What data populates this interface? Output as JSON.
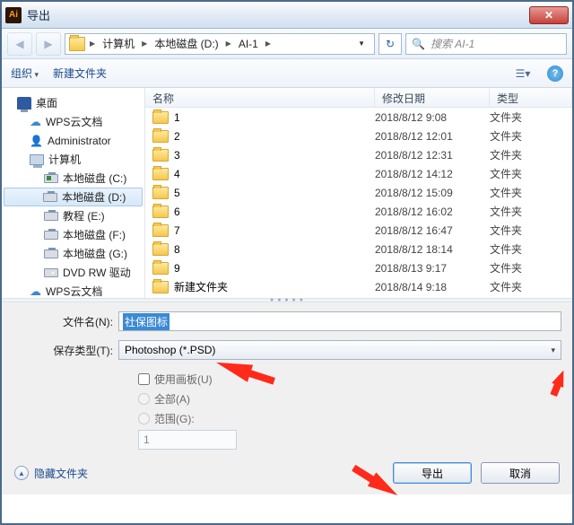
{
  "window": {
    "title": "导出"
  },
  "breadcrumb": {
    "parts": [
      "计算机",
      "本地磁盘 (D:)",
      "AI-1"
    ]
  },
  "search": {
    "placeholder": "搜索 AI-1"
  },
  "toolbar": {
    "organize": "组织",
    "newfolder": "新建文件夹"
  },
  "sidebar": {
    "desktop": "桌面",
    "wps": "WPS云文档",
    "admin": "Administrator",
    "computer": "计算机",
    "driveC": "本地磁盘 (C:)",
    "driveD": "本地磁盘 (D:)",
    "driveE": "教程 (E:)",
    "driveF": "本地磁盘 (F:)",
    "driveG": "本地磁盘 (G:)",
    "dvd": "DVD RW 驱动",
    "wps2": "WPS云文档"
  },
  "columns": {
    "name": "名称",
    "date": "修改日期",
    "type": "类型"
  },
  "files": [
    {
      "name": "1",
      "date": "2018/8/12 9:08",
      "type": "文件夹"
    },
    {
      "name": "2",
      "date": "2018/8/12 12:01",
      "type": "文件夹"
    },
    {
      "name": "3",
      "date": "2018/8/12 12:31",
      "type": "文件夹"
    },
    {
      "name": "4",
      "date": "2018/8/12 14:12",
      "type": "文件夹"
    },
    {
      "name": "5",
      "date": "2018/8/12 15:09",
      "type": "文件夹"
    },
    {
      "name": "6",
      "date": "2018/8/12 16:02",
      "type": "文件夹"
    },
    {
      "name": "7",
      "date": "2018/8/12 16:47",
      "type": "文件夹"
    },
    {
      "name": "8",
      "date": "2018/8/12 18:14",
      "type": "文件夹"
    },
    {
      "name": "9",
      "date": "2018/8/13 9:17",
      "type": "文件夹"
    },
    {
      "name": "新建文件夹",
      "date": "2018/8/14 9:18",
      "type": "文件夹"
    }
  ],
  "form": {
    "filename_label": "文件名(N):",
    "filename_value": "社保图标",
    "savetype_label": "保存类型(T):",
    "savetype_value": "Photoshop (*.PSD)",
    "use_artboard": "使用画板(U)",
    "all": "全部(A)",
    "range": "范围(G):",
    "range_value": "1"
  },
  "footer": {
    "hide_folders": "隐藏文件夹",
    "export": "导出",
    "cancel": "取消"
  }
}
